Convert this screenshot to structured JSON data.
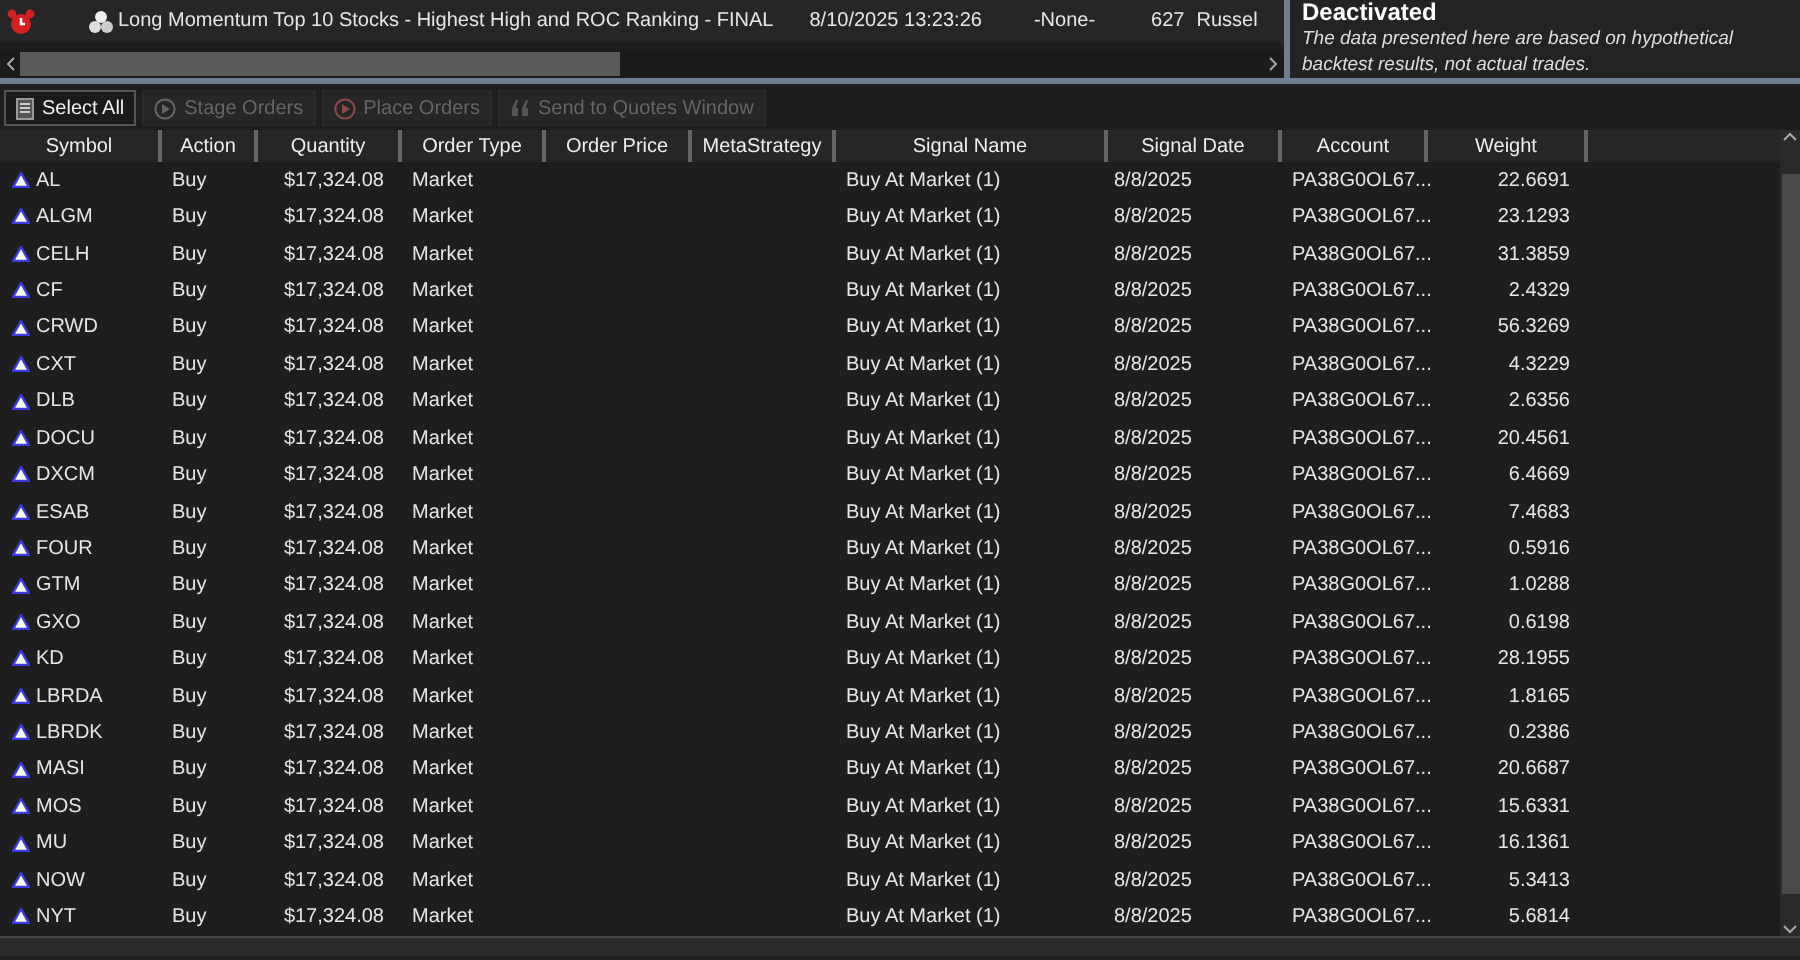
{
  "strategy_bar": {
    "title": "Long Momentum Top 10 Stocks - Highest High and ROC Ranking - FINAL",
    "date": "8/10/2025 13:23:26",
    "meta": "-None-",
    "count": "627",
    "list": "Russel"
  },
  "notice": {
    "title": "Deactivated",
    "text": "The data presented here are based on hypothetical backtest results, not actual trades."
  },
  "toolbar": [
    {
      "label": "Select All",
      "disabled": false,
      "kind": "doc"
    },
    {
      "label": "Stage Orders",
      "disabled": true,
      "kind": "play"
    },
    {
      "label": "Place Orders",
      "disabled": true,
      "kind": "playred"
    },
    {
      "label": "Send to Quotes Window",
      "disabled": true,
      "kind": "quote"
    }
  ],
  "table": {
    "columns": [
      "Symbol",
      "Action",
      "Quantity",
      "Order Type",
      "Order Price",
      "MetaStrategy",
      "Signal Name",
      "Signal Date",
      "Account",
      "Weight"
    ],
    "rows": [
      [
        "AL",
        "Buy",
        "$17,324.08",
        "Market",
        "",
        "",
        "Buy At Market (1)",
        "8/8/2025",
        "PA38G0OL67...",
        "22.6691"
      ],
      [
        "ALGM",
        "Buy",
        "$17,324.08",
        "Market",
        "",
        "",
        "Buy At Market (1)",
        "8/8/2025",
        "PA38G0OL67...",
        "23.1293"
      ],
      [
        "CELH",
        "Buy",
        "$17,324.08",
        "Market",
        "",
        "",
        "Buy At Market (1)",
        "8/8/2025",
        "PA38G0OL67...",
        "31.3859"
      ],
      [
        "CF",
        "Buy",
        "$17,324.08",
        "Market",
        "",
        "",
        "Buy At Market (1)",
        "8/8/2025",
        "PA38G0OL67...",
        "2.4329"
      ],
      [
        "CRWD",
        "Buy",
        "$17,324.08",
        "Market",
        "",
        "",
        "Buy At Market (1)",
        "8/8/2025",
        "PA38G0OL67...",
        "56.3269"
      ],
      [
        "CXT",
        "Buy",
        "$17,324.08",
        "Market",
        "",
        "",
        "Buy At Market (1)",
        "8/8/2025",
        "PA38G0OL67...",
        "4.3229"
      ],
      [
        "DLB",
        "Buy",
        "$17,324.08",
        "Market",
        "",
        "",
        "Buy At Market (1)",
        "8/8/2025",
        "PA38G0OL67...",
        "2.6356"
      ],
      [
        "DOCU",
        "Buy",
        "$17,324.08",
        "Market",
        "",
        "",
        "Buy At Market (1)",
        "8/8/2025",
        "PA38G0OL67...",
        "20.4561"
      ],
      [
        "DXCM",
        "Buy",
        "$17,324.08",
        "Market",
        "",
        "",
        "Buy At Market (1)",
        "8/8/2025",
        "PA38G0OL67...",
        "6.4669"
      ],
      [
        "ESAB",
        "Buy",
        "$17,324.08",
        "Market",
        "",
        "",
        "Buy At Market (1)",
        "8/8/2025",
        "PA38G0OL67...",
        "7.4683"
      ],
      [
        "FOUR",
        "Buy",
        "$17,324.08",
        "Market",
        "",
        "",
        "Buy At Market (1)",
        "8/8/2025",
        "PA38G0OL67...",
        "0.5916"
      ],
      [
        "GTM",
        "Buy",
        "$17,324.08",
        "Market",
        "",
        "",
        "Buy At Market (1)",
        "8/8/2025",
        "PA38G0OL67...",
        "1.0288"
      ],
      [
        "GXO",
        "Buy",
        "$17,324.08",
        "Market",
        "",
        "",
        "Buy At Market (1)",
        "8/8/2025",
        "PA38G0OL67...",
        "0.6198"
      ],
      [
        "KD",
        "Buy",
        "$17,324.08",
        "Market",
        "",
        "",
        "Buy At Market (1)",
        "8/8/2025",
        "PA38G0OL67...",
        "28.1955"
      ],
      [
        "LBRDA",
        "Buy",
        "$17,324.08",
        "Market",
        "",
        "",
        "Buy At Market (1)",
        "8/8/2025",
        "PA38G0OL67...",
        "1.8165"
      ],
      [
        "LBRDK",
        "Buy",
        "$17,324.08",
        "Market",
        "",
        "",
        "Buy At Market (1)",
        "8/8/2025",
        "PA38G0OL67...",
        "0.2386"
      ],
      [
        "MASI",
        "Buy",
        "$17,324.08",
        "Market",
        "",
        "",
        "Buy At Market (1)",
        "8/8/2025",
        "PA38G0OL67...",
        "20.6687"
      ],
      [
        "MOS",
        "Buy",
        "$17,324.08",
        "Market",
        "",
        "",
        "Buy At Market (1)",
        "8/8/2025",
        "PA38G0OL67...",
        "15.6331"
      ],
      [
        "MU",
        "Buy",
        "$17,324.08",
        "Market",
        "",
        "",
        "Buy At Market (1)",
        "8/8/2025",
        "PA38G0OL67...",
        "16.1361"
      ],
      [
        "NOW",
        "Buy",
        "$17,324.08",
        "Market",
        "",
        "",
        "Buy At Market (1)",
        "8/8/2025",
        "PA38G0OL67...",
        "5.3413"
      ],
      [
        "NYT",
        "Buy",
        "$17,324.08",
        "Market",
        "",
        "",
        "Buy At Market (1)",
        "8/8/2025",
        "PA38G0OL67...",
        "5.6814"
      ]
    ]
  }
}
